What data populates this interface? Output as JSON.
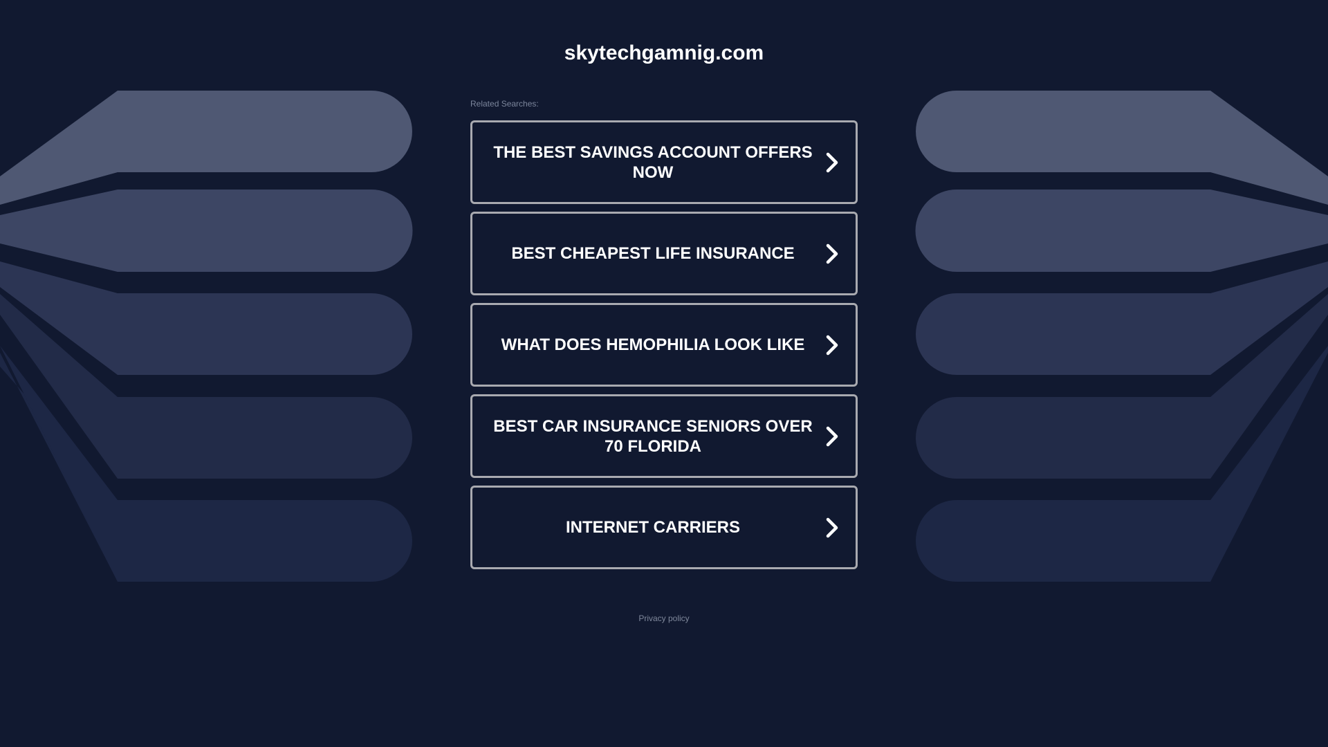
{
  "site": {
    "domain": "skytechgamnig.com"
  },
  "related_searches": {
    "heading": "Related Searches:",
    "items": [
      {
        "label": "THE BEST SAVINGS ACCOUNT OFFERS NOW"
      },
      {
        "label": "BEST CHEAPEST LIFE INSURANCE"
      },
      {
        "label": "WHAT DOES HEMOPHILIA LOOK LIKE"
      },
      {
        "label": "BEST CAR INSURANCE SENIORS OVER 70 FLORIDA"
      },
      {
        "label": "INTERNET CARRIERS"
      }
    ]
  },
  "footer": {
    "privacy_label": "Privacy policy"
  },
  "icons": {
    "link_arrow": "chevron-right-icon"
  },
  "colors": {
    "background": "#111930",
    "text": "#ffffff",
    "button_border": "#a9aab0",
    "muted_text": "#7c869c",
    "band_1": "#4f5873",
    "band_2": "#3d4664",
    "band_3": "#2c3554",
    "band_4": "#222b48",
    "band_5": "#1d2745"
  }
}
